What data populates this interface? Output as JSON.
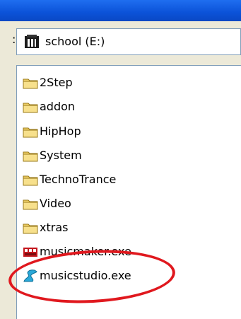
{
  "window": {
    "look_in_colon": ":",
    "drive": {
      "label": "school (E:)",
      "icon": "drive-icon"
    }
  },
  "files": [
    {
      "name": "2Step",
      "type": "folder",
      "icon": "folder-icon"
    },
    {
      "name": "addon",
      "type": "folder",
      "icon": "folder-icon"
    },
    {
      "name": "HipHop",
      "type": "folder",
      "icon": "folder-icon"
    },
    {
      "name": "System",
      "type": "folder",
      "icon": "folder-icon"
    },
    {
      "name": "TechnoTrance",
      "type": "folder",
      "icon": "folder-icon"
    },
    {
      "name": "Video",
      "type": "folder",
      "icon": "folder-icon"
    },
    {
      "name": "xtras",
      "type": "folder",
      "icon": "folder-icon"
    },
    {
      "name": "musicmaker.exe",
      "type": "exe",
      "icon": "musicmaker-app-icon"
    },
    {
      "name": "musicstudio.exe",
      "type": "exe",
      "icon": "musicstudio-app-icon",
      "highlighted": true
    }
  ],
  "colors": {
    "titlebar": "#0b52d8",
    "folder": "#f2d36b",
    "highlight_circle": "#e0181e",
    "window_bg": "#ece9d8"
  }
}
